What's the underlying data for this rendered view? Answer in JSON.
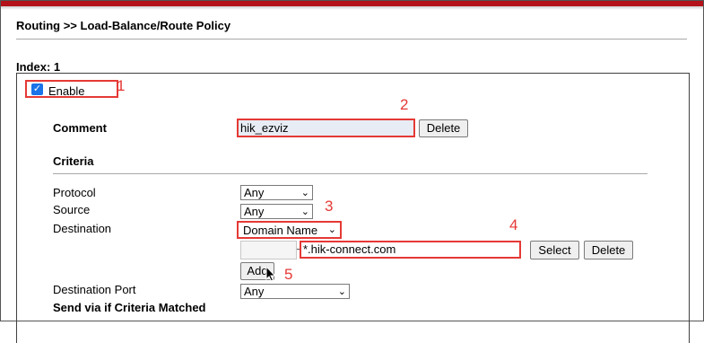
{
  "header": {
    "title": "Routing >> Load-Balance/Route Policy"
  },
  "index_label": "Index: 1",
  "enable": {
    "label": "Enable",
    "checked": true
  },
  "comment": {
    "label": "Comment",
    "value": "hik_ezviz",
    "delete_label": "Delete"
  },
  "criteria": {
    "heading": "Criteria",
    "protocol": {
      "label": "Protocol",
      "value": "Any"
    },
    "source": {
      "label": "Source",
      "value": "Any"
    },
    "destination": {
      "label": "Destination",
      "value": "Domain Name",
      "domain_value": "*.hik-connect.com",
      "select_label": "Select",
      "delete_label": "Delete",
      "add_label": "Add"
    },
    "destination_port": {
      "label": "Destination Port",
      "value": "Any"
    }
  },
  "send_via_heading": "Send via if Criteria Matched",
  "annotations": [
    "1",
    "2",
    "3",
    "4",
    "5"
  ],
  "colors": {
    "top_bar": "#b3121a",
    "annotation": "#e53935",
    "checkbox": "#1a73e8"
  },
  "icons": {
    "checkbox": "checkmark-icon",
    "dropdown": "chevron-down-icon",
    "cursor": "mouse-pointer-icon"
  }
}
